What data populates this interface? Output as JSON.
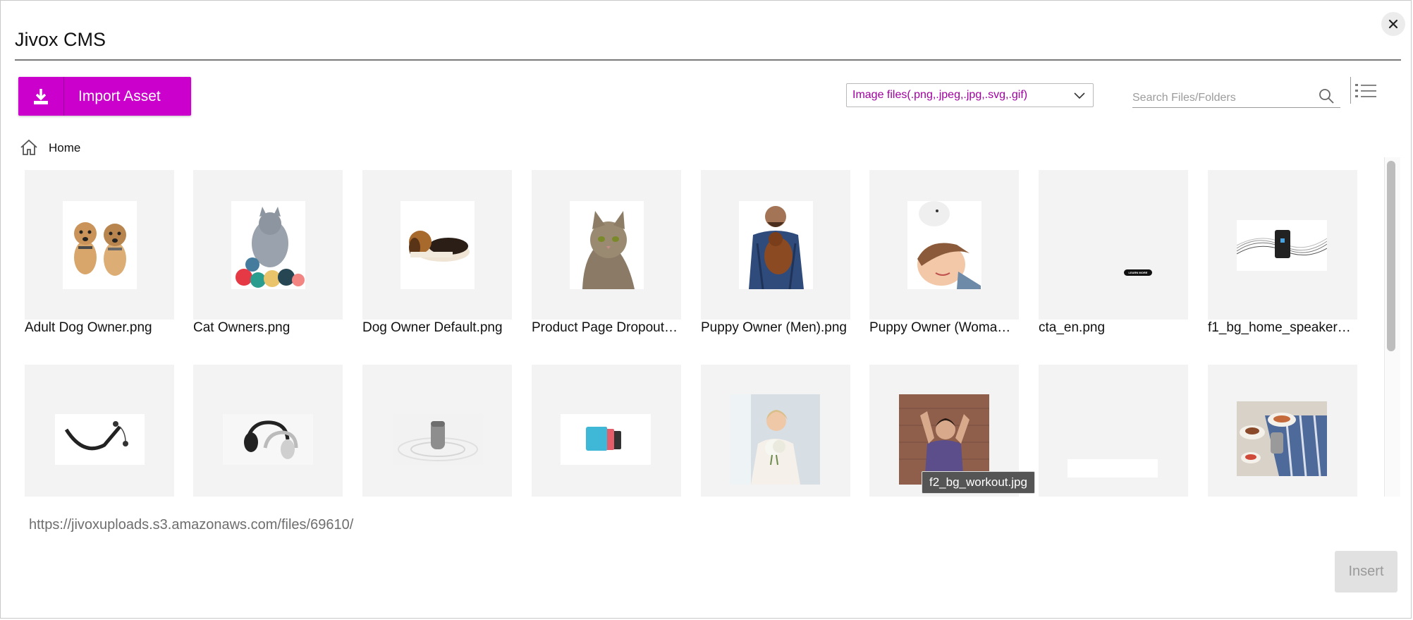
{
  "app_title": "Jivox CMS",
  "toolbar": {
    "import_label": "Import Asset",
    "filter_value": "Image files(.png,.jpeg,.jpg,.svg,.gif)",
    "search_placeholder": "Search Files/Folders"
  },
  "breadcrumb": {
    "home_label": "Home"
  },
  "files": [
    {
      "name": "Adult Dog Owner.png",
      "art": "dogs"
    },
    {
      "name": "Cat Owners.png",
      "art": "cat-yarn"
    },
    {
      "name": "Dog Owner Default.png",
      "art": "beagle"
    },
    {
      "name": "Product Page Dropout…",
      "art": "tabby"
    },
    {
      "name": "Puppy Owner (Men).png",
      "art": "man-dog"
    },
    {
      "name": "Puppy Owner (Woma…",
      "art": "woman-dog"
    },
    {
      "name": "cta_en.png",
      "art": "cta"
    },
    {
      "name": "f1_bg_home_speaker…",
      "art": "speaker-wave"
    },
    {
      "name": "",
      "art": "neckband"
    },
    {
      "name": "",
      "art": "headphones"
    },
    {
      "name": "",
      "art": "speaker-ripple"
    },
    {
      "name": "",
      "art": "speakers-color"
    },
    {
      "name": "",
      "art": "bride"
    },
    {
      "name": "",
      "art": "workout"
    },
    {
      "name": "",
      "art": "blank-banner"
    },
    {
      "name": "",
      "art": "dinner"
    }
  ],
  "cta_text": "LEARN MORE",
  "tooltip": "f2_bg_workout.jpg",
  "footer": {
    "url": "https://jivoxuploads.s3.amazonaws.com/files/69610/",
    "insert_label": "Insert"
  },
  "colors": {
    "accent": "#cc00cc",
    "filter_text": "#a000a0"
  }
}
